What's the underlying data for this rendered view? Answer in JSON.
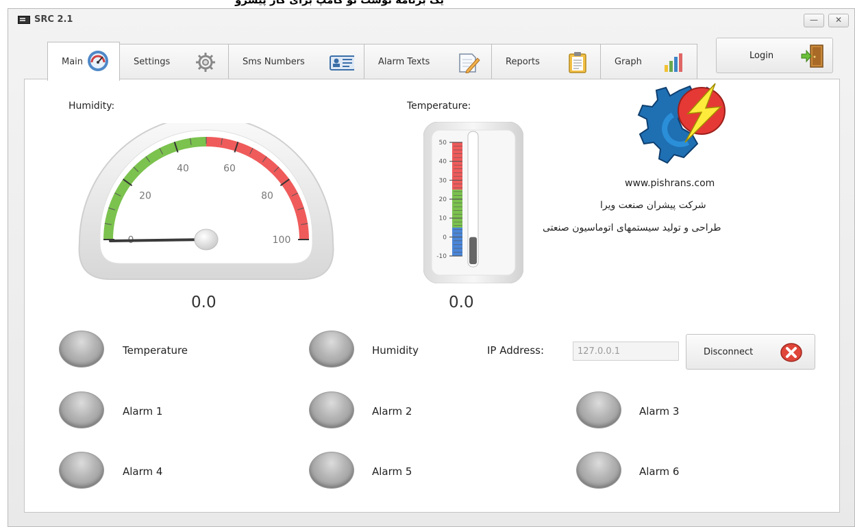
{
  "overflow_text": "یک برنامه نوشت تو کامپ برای کار پیشرو",
  "window": {
    "title": "SRC 2.1",
    "minimize_glyph": "—",
    "close_glyph": "✕"
  },
  "tabs": [
    {
      "label": "Main",
      "icon": "speedometer-icon",
      "active": true
    },
    {
      "label": "Settings",
      "icon": "gear-icon",
      "active": false
    },
    {
      "label": "Sms Numbers",
      "icon": "contact-card-icon",
      "active": false
    },
    {
      "label": "Alarm Texts",
      "icon": "notepad-pencil-icon",
      "active": false
    },
    {
      "label": "Reports",
      "icon": "clipboard-icon",
      "active": false
    },
    {
      "label": "Graph",
      "icon": "bar-graph-icon",
      "active": false
    }
  ],
  "login": {
    "label": "Login",
    "icon": "door-enter-icon"
  },
  "humidity": {
    "label": "Humidity:",
    "value_text": "0.0",
    "value": 0,
    "min": 0,
    "max": 100,
    "ticks": [
      "0",
      "20",
      "40",
      "60",
      "80",
      "100"
    ],
    "colors": {
      "low": "#7bc24e",
      "high": "#ef5b5b"
    }
  },
  "temperature": {
    "label": "Temperature:",
    "value_text": "0.0",
    "value": 0,
    "min": -10,
    "max": 50,
    "ticks": [
      "50",
      "40",
      "30",
      "20",
      "10",
      "0",
      "-10"
    ],
    "colors": {
      "hot": "#ef5b5b",
      "mid": "#7bc24e",
      "cold": "#4a86d8",
      "fill": "#666666"
    }
  },
  "company": {
    "website": "www.pishrans.com",
    "name_fa": "شرکت پیشران صنعت ویرا",
    "tagline_fa": "طراحی و تولید سیستمهای اتوماسیون صنعتی"
  },
  "status_leds": {
    "temperature": "Temperature",
    "humidity": "Humidity"
  },
  "connection": {
    "ip_label": "IP Address:",
    "ip_value": "127.0.0.1",
    "disconnect_label": "Disconnect",
    "disconnect_icon": "close-circle-icon"
  },
  "alarms": [
    "Alarm 1",
    "Alarm 2",
    "Alarm 3",
    "Alarm 4",
    "Alarm 5",
    "Alarm 6"
  ]
}
